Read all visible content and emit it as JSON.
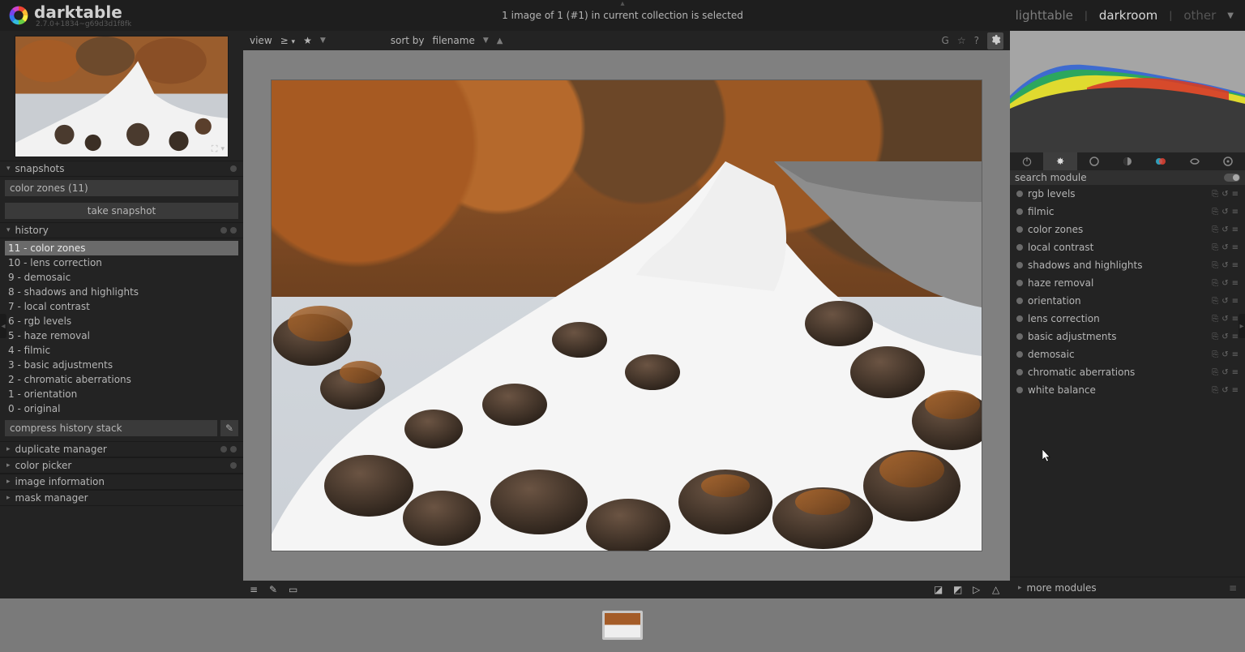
{
  "app": {
    "name": "darktable",
    "version": "2.7.0+1834~g69d3d1f8fk"
  },
  "header": {
    "center": "1 image of 1 (#1) in current collection is selected",
    "views": {
      "lighttable": "lighttable",
      "darkroom": "darkroom",
      "other": "other"
    }
  },
  "center_toolbar": {
    "view_label": "view",
    "view_op": "≥",
    "sort_label": "sort by",
    "sort_value": "filename"
  },
  "left": {
    "sections": {
      "snapshots": "snapshots",
      "history": "history",
      "duplicate": "duplicate manager",
      "colorpicker": "color picker",
      "imageinfo": "image information",
      "maskmgr": "mask manager"
    },
    "snapshot_name": "color zones (11)",
    "take_snapshot": "take snapshot",
    "history_items": [
      "11 - color zones",
      "10 - lens correction",
      "9 - demosaic",
      "8 - shadows and highlights",
      "7 - local contrast",
      "6 - rgb levels",
      "5 - haze removal",
      "4 - filmic",
      "3 - basic adjustments",
      "2 - chromatic aberrations",
      "1 - orientation",
      "0 - original"
    ],
    "history_selected_index": 0,
    "compress": "compress history stack"
  },
  "right": {
    "search_label": "search module",
    "modules": [
      "rgb levels",
      "filmic",
      "color zones",
      "local contrast",
      "shadows and highlights",
      "haze removal",
      "orientation",
      "lens correction",
      "basic adjustments",
      "demosaic",
      "chromatic aberrations",
      "white balance"
    ],
    "more": "more modules"
  }
}
